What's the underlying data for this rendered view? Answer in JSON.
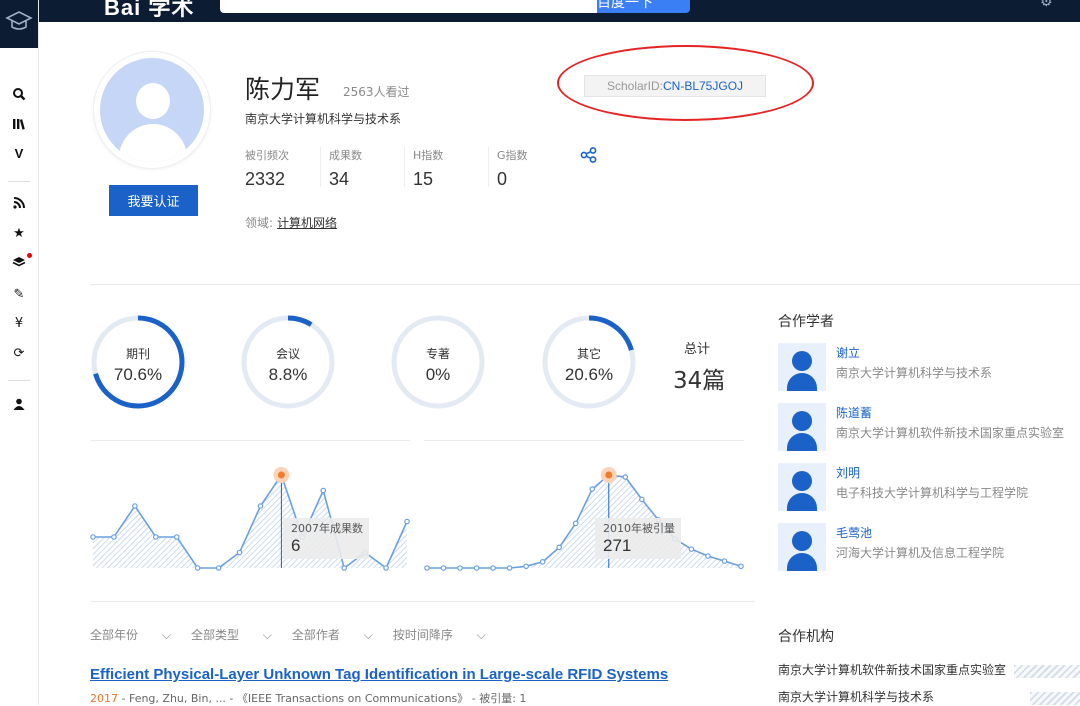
{
  "header": {
    "logo": "Bai 学术",
    "search_placeholder": "",
    "search_button": "百度一下"
  },
  "profile": {
    "name": "陈力军",
    "views": "2563人看过",
    "affiliation": "南京大学计算机科学与技术系",
    "scholar_id_label": "ScholarID:",
    "scholar_id": "CN-BL75JGOJ",
    "claim_button": "我要认证",
    "stats": [
      {
        "label": "被引频次",
        "value": "2332"
      },
      {
        "label": "成果数",
        "value": "34"
      },
      {
        "label": "H指数",
        "value": "15"
      },
      {
        "label": "G指数",
        "value": "0"
      }
    ],
    "field_label": "领域:",
    "field_value": "计算机网络"
  },
  "breakdown": {
    "items": [
      {
        "label": "期刊",
        "percent": "70.6%",
        "fraction": 0.706
      },
      {
        "label": "会议",
        "percent": "8.8%",
        "fraction": 0.088
      },
      {
        "label": "专著",
        "percent": "0%",
        "fraction": 0
      },
      {
        "label": "其它",
        "percent": "20.6%",
        "fraction": 0.206
      }
    ],
    "total_label": "总计",
    "total_value": "34篇"
  },
  "chart_data": [
    {
      "type": "area",
      "series": [
        {
          "values": [
            2,
            2,
            4,
            2,
            2,
            0,
            0,
            1,
            4,
            6,
            2,
            5,
            0,
            1,
            0,
            3
          ]
        }
      ],
      "tooltip": {
        "label": "2007年成果数",
        "value": "6",
        "highlight_index": 9
      }
    },
    {
      "type": "area",
      "series": [
        {
          "values": [
            0,
            0,
            0,
            0,
            0,
            0,
            5,
            18,
            60,
            130,
            230,
            271,
            265,
            200,
            140,
            85,
            55,
            35,
            20,
            5
          ]
        }
      ],
      "tooltip": {
        "label": "2010年被引量",
        "value": "271",
        "highlight_index": 11
      }
    }
  ],
  "filters": [
    "全部年份",
    "全部类型",
    "全部作者",
    "按时间降序"
  ],
  "papers": [
    {
      "title": "Efficient Physical-Layer Unknown Tag Identification in Large-scale RFID Systems",
      "year": "2017",
      "meta": " - Feng, Zhu, Bin, ... - 《IEEE Transactions on Communications》 - 被引量: 1"
    }
  ],
  "coauthors": {
    "title": "合作学者",
    "items": [
      {
        "name": "谢立",
        "affiliation": "南京大学计算机科学与技术系"
      },
      {
        "name": "陈道蓄",
        "affiliation": "南京大学计算机软件新技术国家重点实验室"
      },
      {
        "name": "刘明",
        "affiliation": "电子科技大学计算机科学与工程学院"
      },
      {
        "name": "毛莺池",
        "affiliation": "河海大学计算机及信息工程学院"
      }
    ]
  },
  "institutions": {
    "title": "合作机构",
    "items": [
      {
        "name": "南京大学计算机软件新技术国家重点实验室"
      },
      {
        "name": "南京大学计算机科学与技术系"
      }
    ]
  }
}
